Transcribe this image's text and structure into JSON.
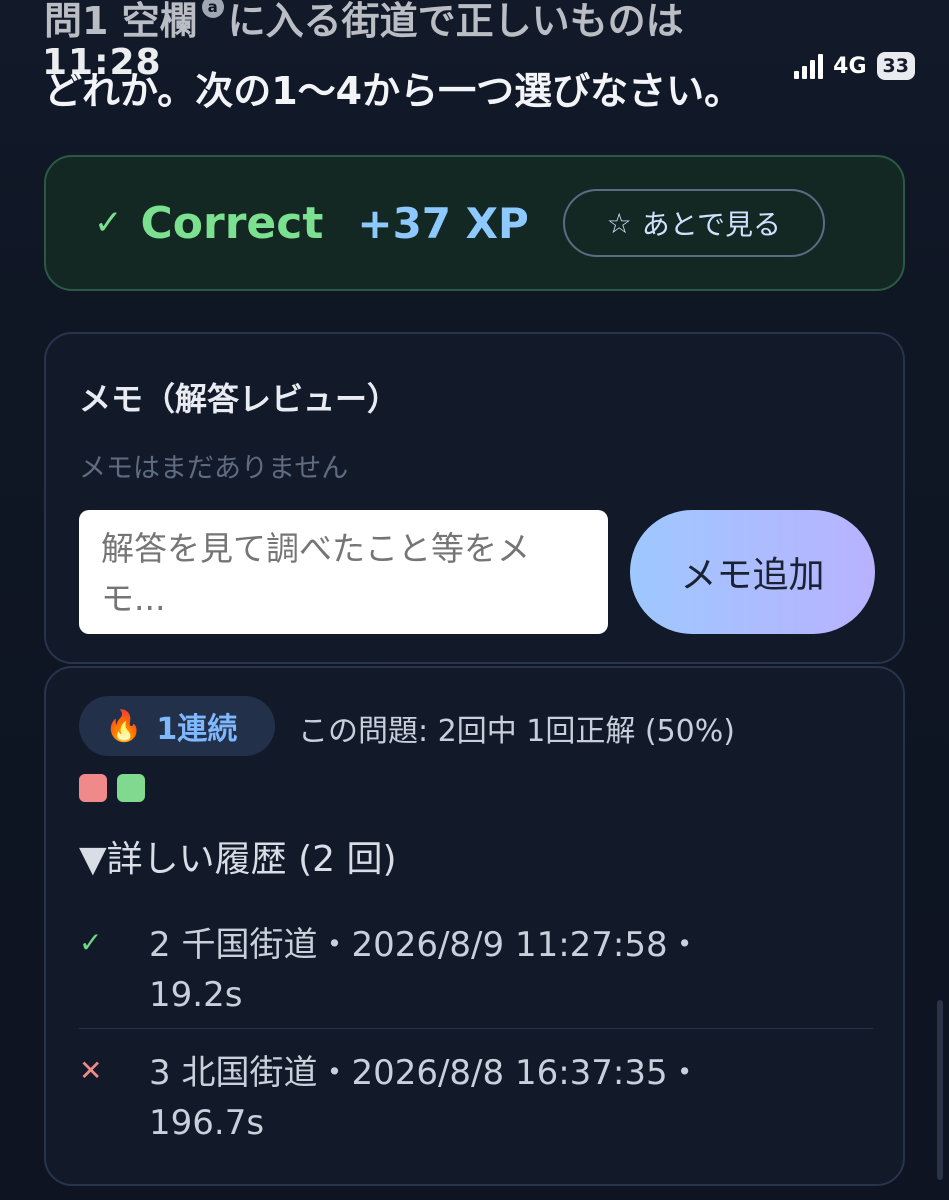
{
  "question": {
    "line1_a": "問1 空欄",
    "line1_sup": "a",
    "line1_b": "に入る街道で正しいものは",
    "line2": "どれか。次の1～4から一つ選びなさい。"
  },
  "status_bar": {
    "time": "11:28",
    "network": "4G",
    "battery": "33"
  },
  "result": {
    "check_icon": "✓",
    "label": "Correct",
    "xp": "+37 XP",
    "later_icon": "☆",
    "later_label": "あとで見る",
    "accent_color": "#7be08f"
  },
  "memo": {
    "title": "メモ（解答レビュー）",
    "empty_text": "メモはまだありません",
    "input_placeholder": "解答を見て調べたこと等をメモ...",
    "add_button": "メモ追加"
  },
  "stats": {
    "streak_icon": "🔥",
    "streak_label": "1連続",
    "summary": "この問題: 2回中 1回正解 (50%)",
    "dots": [
      {
        "result": "wrong",
        "color": "#f08a8a"
      },
      {
        "result": "correct",
        "color": "#7fd98f"
      }
    ],
    "history_toggle": "▼詳しい履歴 (2 回)",
    "history": [
      {
        "mark": "✓",
        "text": "2 千国街道・2026/8/9 11:27:58・19.2s"
      },
      {
        "mark": "✕",
        "text": "3 北国街道・2026/8/8 16:37:35・196.7s"
      }
    ]
  }
}
